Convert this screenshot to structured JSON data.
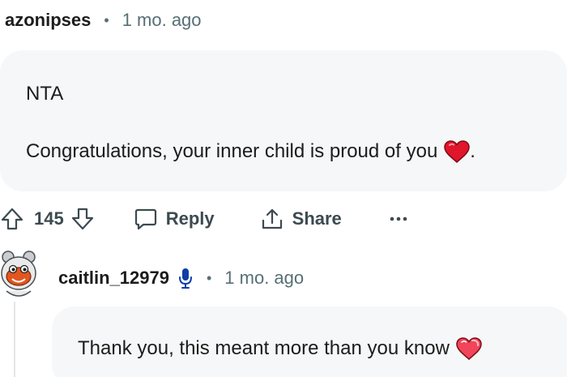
{
  "comment1": {
    "username": "azonipses",
    "separator": "•",
    "timestamp": "1 mo. ago",
    "body_line1": "NTA",
    "body_line2": "Congratulations, your inner child is proud of you",
    "body_suffix": "."
  },
  "actions": {
    "upvote_icon": "upvote-arrow-icon",
    "vote_count": "145",
    "downvote_icon": "downvote-arrow-icon",
    "reply_label": "Reply",
    "share_label": "Share",
    "more_label": "•••"
  },
  "comment2": {
    "username": "caitlin_12979",
    "separator": "•",
    "timestamp": "1 mo. ago",
    "body": "Thank you, this meant more than you know"
  },
  "colors": {
    "bubble": "#f6f7f8",
    "muted": "#576f76",
    "mic_blue": "#0b3fa8",
    "heart_red": "#e0162b"
  }
}
